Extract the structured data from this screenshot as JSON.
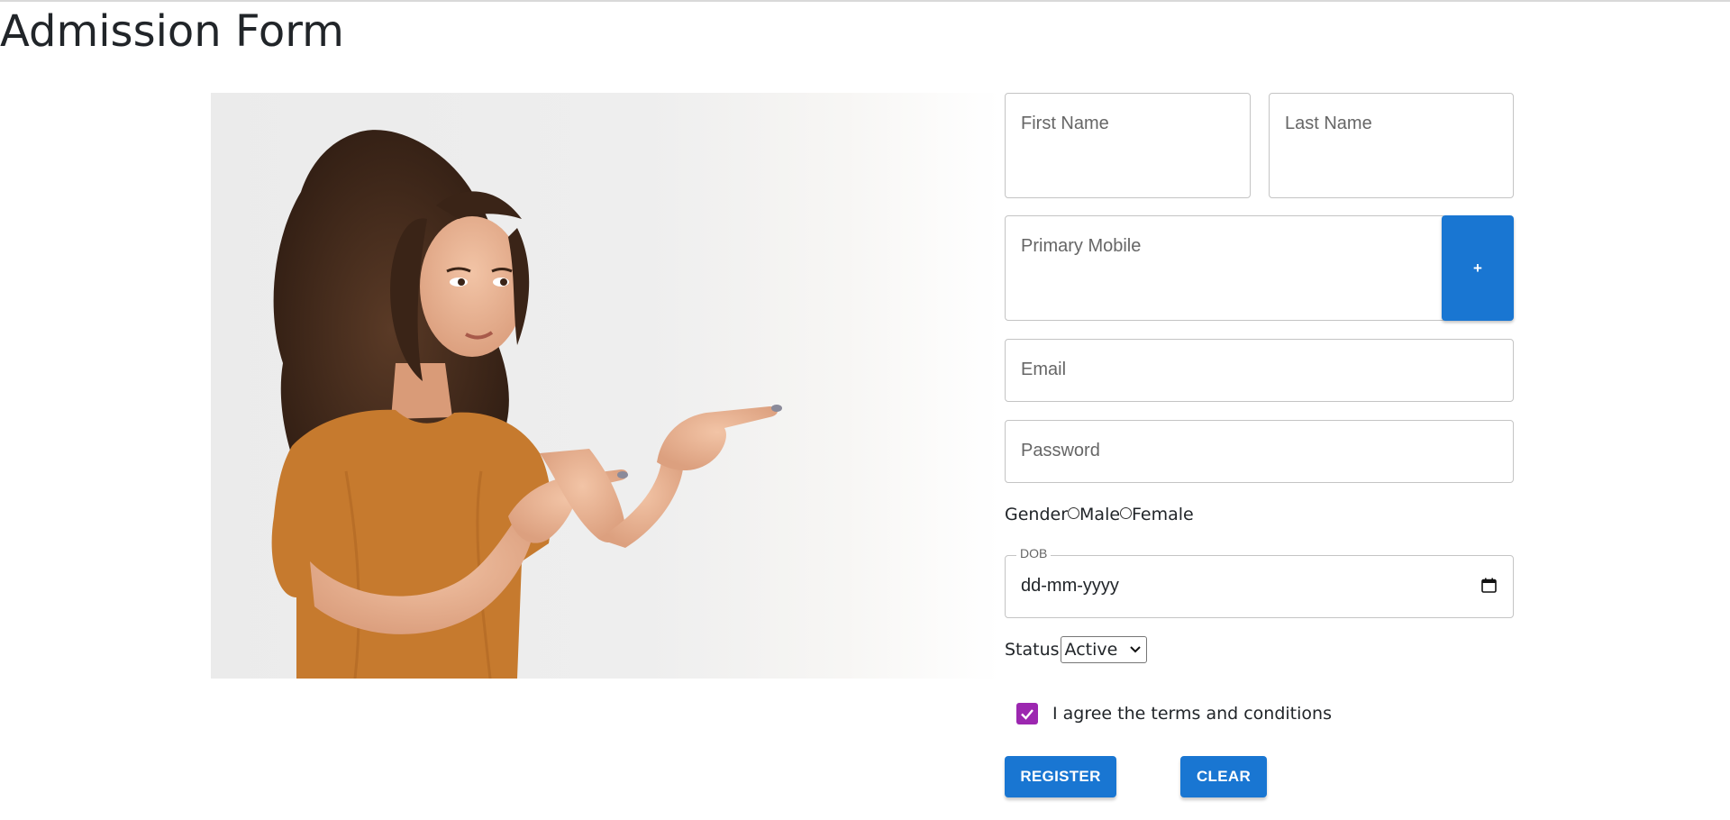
{
  "page": {
    "title": "Admission Form"
  },
  "hero": {
    "alt": "smiling woman pointing to the right"
  },
  "form": {
    "first_name": {
      "placeholder": "First Name",
      "value": ""
    },
    "last_name": {
      "placeholder": "Last Name",
      "value": ""
    },
    "primary_mobile": {
      "placeholder": "Primary Mobile",
      "value": ""
    },
    "add_mobile_label": "+",
    "email": {
      "placeholder": "Email",
      "value": ""
    },
    "password": {
      "placeholder": "Password",
      "value": ""
    },
    "gender": {
      "label": "Gender",
      "options": [
        "Male",
        "Female"
      ],
      "selected": null
    },
    "dob": {
      "label": "DOB",
      "value": "dd-mm-yyyy",
      "icon": "calendar-icon"
    },
    "status": {
      "label": "Status",
      "selected": "Active"
    },
    "terms": {
      "label": "I agree the terms and conditions",
      "checked": true
    },
    "register_label": "REGISTER",
    "clear_label": "CLEAR"
  },
  "colors": {
    "primary": "#1976d2",
    "checkbox": "#9c27b0",
    "border": "#c4c4c4",
    "shirt": "#c67a2e"
  }
}
